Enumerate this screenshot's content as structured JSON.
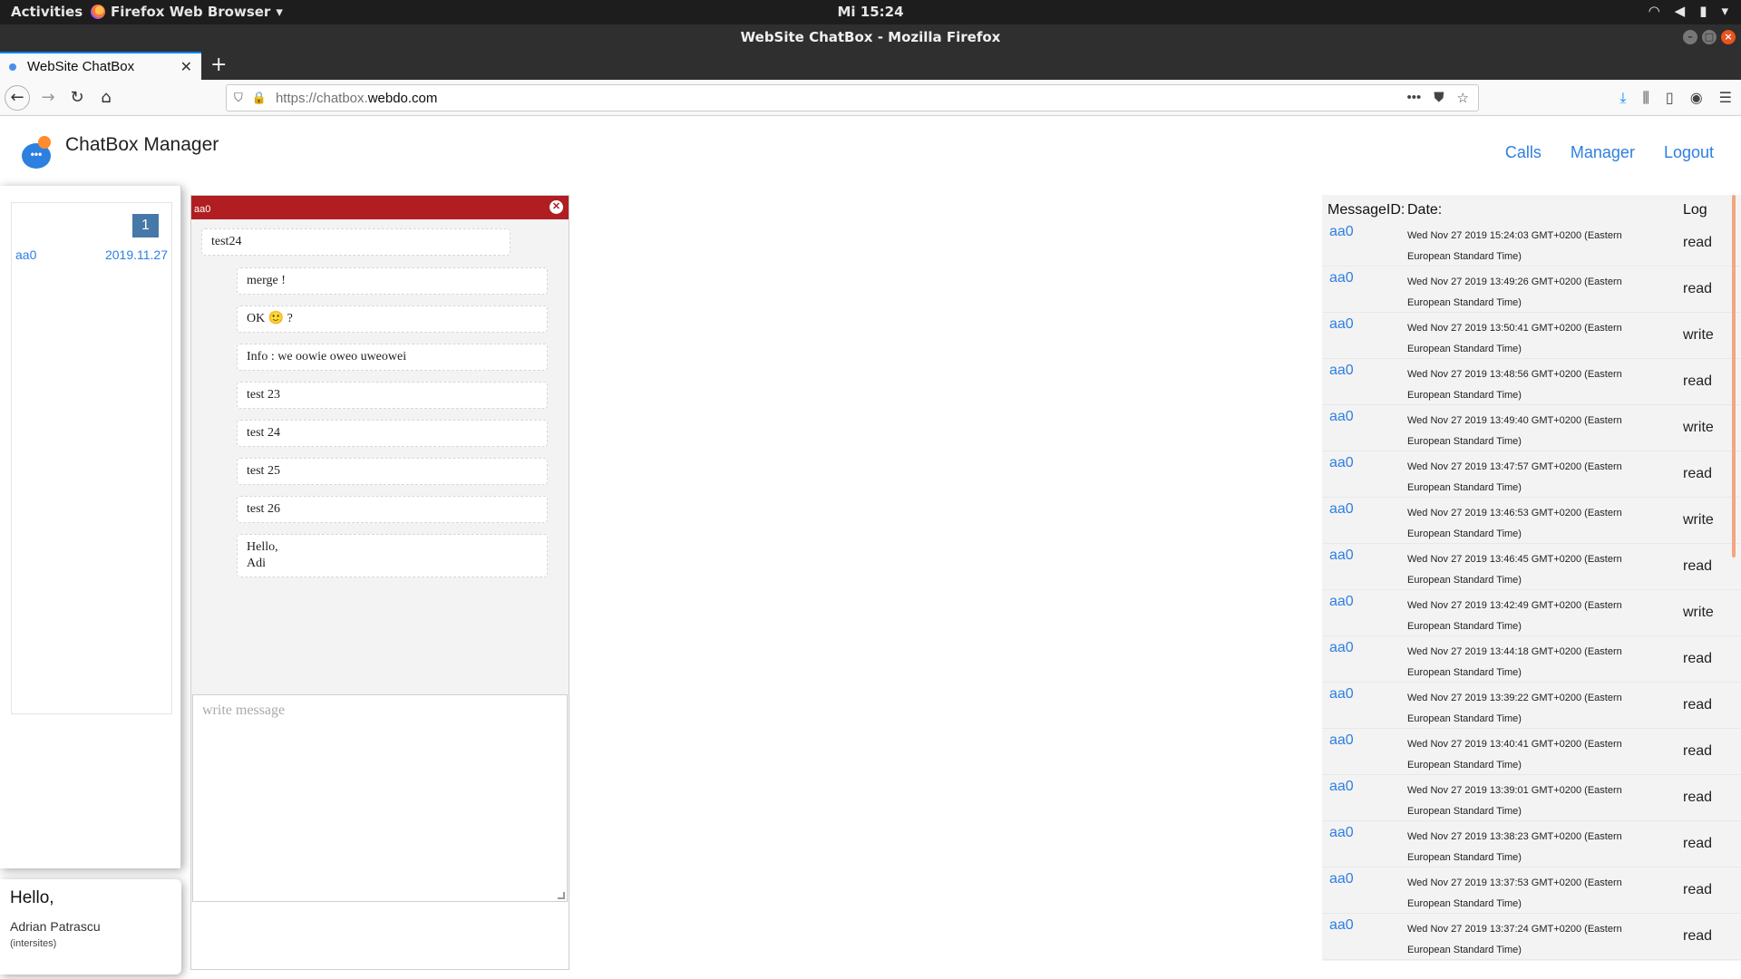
{
  "system_bar": {
    "activities": "Activities",
    "app_menu": "Firefox Web Browser",
    "clock": "Mi 15:24"
  },
  "window": {
    "title": "WebSite ChatBox - Mozilla Firefox"
  },
  "browser": {
    "tab_title": "WebSite ChatBox",
    "url_prefix": "https://chatbox.",
    "url_domain": "webdo.com"
  },
  "app": {
    "title": "ChatBox Manager",
    "nav": [
      "Calls",
      "Manager",
      "Logout"
    ]
  },
  "sidebar": {
    "badge": "1",
    "contact_name": "aa0",
    "contact_date": "2019.11.27"
  },
  "user_card": {
    "greeting": "Hello,",
    "name": "Adrian Patrascu",
    "org": "(intersites)"
  },
  "chat": {
    "contact": "aa0",
    "messages": [
      {
        "text": "test24",
        "dir": "in"
      },
      {
        "text": "merge !",
        "dir": "out"
      },
      {
        "text": "OK 🙂 ?",
        "dir": "out"
      },
      {
        "text": "Info : we oowie oweo uweowei",
        "dir": "out"
      },
      {
        "text": "test 23",
        "dir": "out"
      },
      {
        "text": "test 24",
        "dir": "out"
      },
      {
        "text": "test 25",
        "dir": "out"
      },
      {
        "text": "test 26",
        "dir": "out"
      },
      {
        "text": "Hello,\nAdi",
        "dir": "out"
      }
    ],
    "compose_placeholder": "write message"
  },
  "log": {
    "headers": {
      "message_id": "MessageID:",
      "date": "Date:",
      "log": "Log"
    },
    "rows": [
      {
        "id": "aa0",
        "date": "Wed Nov 27 2019 15:24:03 GMT+0200 (Eastern European Standard Time)",
        "log": "read"
      },
      {
        "id": "aa0",
        "date": "Wed Nov 27 2019 13:49:26 GMT+0200 (Eastern European Standard Time)",
        "log": "read"
      },
      {
        "id": "aa0",
        "date": "Wed Nov 27 2019 13:50:41 GMT+0200 (Eastern European Standard Time)",
        "log": "write"
      },
      {
        "id": "aa0",
        "date": "Wed Nov 27 2019 13:48:56 GMT+0200 (Eastern European Standard Time)",
        "log": "read"
      },
      {
        "id": "aa0",
        "date": "Wed Nov 27 2019 13:49:40 GMT+0200 (Eastern European Standard Time)",
        "log": "write"
      },
      {
        "id": "aa0",
        "date": "Wed Nov 27 2019 13:47:57 GMT+0200 (Eastern European Standard Time)",
        "log": "read"
      },
      {
        "id": "aa0",
        "date": "Wed Nov 27 2019 13:46:53 GMT+0200 (Eastern European Standard Time)",
        "log": "write"
      },
      {
        "id": "aa0",
        "date": "Wed Nov 27 2019 13:46:45 GMT+0200 (Eastern European Standard Time)",
        "log": "read"
      },
      {
        "id": "aa0",
        "date": "Wed Nov 27 2019 13:42:49 GMT+0200 (Eastern European Standard Time)",
        "log": "write"
      },
      {
        "id": "aa0",
        "date": "Wed Nov 27 2019 13:44:18 GMT+0200 (Eastern European Standard Time)",
        "log": "read"
      },
      {
        "id": "aa0",
        "date": "Wed Nov 27 2019 13:39:22 GMT+0200 (Eastern European Standard Time)",
        "log": "read"
      },
      {
        "id": "aa0",
        "date": "Wed Nov 27 2019 13:40:41 GMT+0200 (Eastern European Standard Time)",
        "log": "read"
      },
      {
        "id": "aa0",
        "date": "Wed Nov 27 2019 13:39:01 GMT+0200 (Eastern European Standard Time)",
        "log": "read"
      },
      {
        "id": "aa0",
        "date": "Wed Nov 27 2019 13:38:23 GMT+0200 (Eastern European Standard Time)",
        "log": "read"
      },
      {
        "id": "aa0",
        "date": "Wed Nov 27 2019 13:37:53 GMT+0200 (Eastern European Standard Time)",
        "log": "read"
      },
      {
        "id": "aa0",
        "date": "Wed Nov 27 2019 13:37:24 GMT+0200 (Eastern European Standard Time)",
        "log": "read"
      }
    ]
  },
  "colors": {
    "chat_header": "#b01e22",
    "link_blue": "#2d7fe0",
    "badge": "#4678a8"
  },
  "icons": [
    "firefox-icon",
    "wifi-icon",
    "volume-icon",
    "battery-icon",
    "back-icon",
    "forward-icon",
    "reload-icon",
    "home-icon",
    "shield-icon",
    "lock-icon",
    "download-icon",
    "library-icon",
    "sidebar-icon",
    "account-icon",
    "menu-icon",
    "chatbox-logo-icon",
    "close-icon"
  ]
}
